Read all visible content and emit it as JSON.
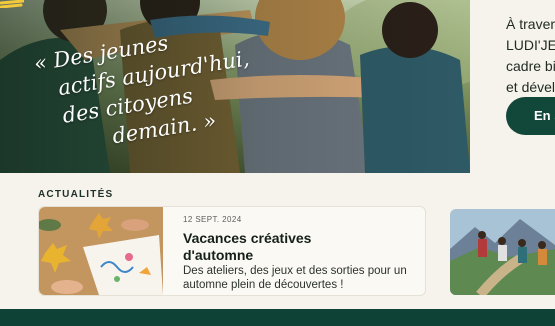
{
  "hero": {
    "quote_lines": [
      "« Des jeunes",
      "actifs aujourd'hui,",
      "des citoyens",
      "demain. »"
    ]
  },
  "side": {
    "text_lines": [
      "À travers",
      "LUDI'JEU",
      "cadre bi",
      "et dével"
    ],
    "button_label": "En s"
  },
  "news": {
    "section_label": "ACTUALITÉS",
    "cards": [
      {
        "date": "12 SEPT. 2024",
        "title": "Vacances créatives d'automne",
        "description": "Des ateliers, des jeux et des sorties pour un automne plein de découvertes !"
      }
    ]
  },
  "colors": {
    "primary": "#12483a",
    "footer": "#0f4236",
    "background": "#f6f3ec",
    "accent_yellow": "#f2c93d"
  }
}
